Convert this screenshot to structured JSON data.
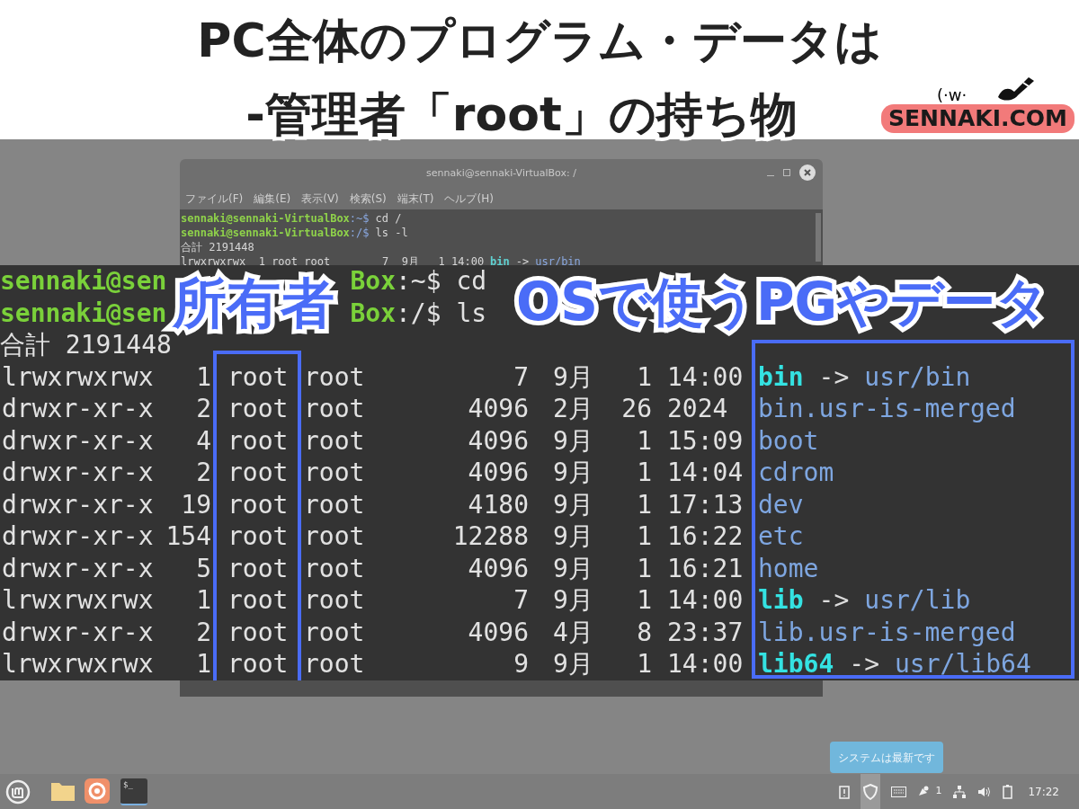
{
  "headline": [
    "PC全体のプログラム・データは",
    "-管理者「root」の持ち物"
  ],
  "logo": {
    "face": "(·w·",
    "text": "SENNAKI.COM"
  },
  "window": {
    "title": "sennaki@sennaki-VirtualBox: /",
    "menu": [
      "ファイル(F)",
      "編集(E)",
      "表示(V)",
      "検索(S)",
      "端末(T)",
      "ヘルプ(H)"
    ],
    "prompts": [
      {
        "user": "sennaki@sennaki-VirtualBox",
        "path": ":~$",
        "command": "cd /"
      },
      {
        "user": "sennaki@sennaki-VirtualBox",
        "path": ":/$",
        "command": "ls -l"
      }
    ],
    "total": "合計 2191448",
    "entry": {
      "info": "lrwxrwxrwx  1 root root        7  9月   1 14:00",
      "name": "bin",
      "arrow": "->",
      "target": "usr/bin"
    }
  },
  "zoom": {
    "prompts": [
      {
        "user_start": "sennaki@sen",
        "user_end": "Box",
        "rest": ":~$ cd"
      },
      {
        "user_start": "sennaki@sen",
        "user_end": "Box",
        "rest": ":/$ ls"
      }
    ],
    "total": "合計 2191448",
    "rows": [
      {
        "perms": "lrwxrwxrwx",
        "links": "1",
        "owner": "root",
        "group": "root",
        "size": "7",
        "month": "9月",
        "day": "1",
        "time": "14:00",
        "name": "bin",
        "kind": "link",
        "arrow": "->",
        "target": "usr/bin"
      },
      {
        "perms": "drwxr-xr-x",
        "links": "2",
        "owner": "root",
        "group": "root",
        "size": "4096",
        "month": "2月",
        "day": "26",
        "time": "2024",
        "name": "bin.usr-is-merged",
        "kind": "dir"
      },
      {
        "perms": "drwxr-xr-x",
        "links": "4",
        "owner": "root",
        "group": "root",
        "size": "4096",
        "month": "9月",
        "day": "1",
        "time": "15:09",
        "name": "boot",
        "kind": "dir"
      },
      {
        "perms": "drwxr-xr-x",
        "links": "2",
        "owner": "root",
        "group": "root",
        "size": "4096",
        "month": "9月",
        "day": "1",
        "time": "14:04",
        "name": "cdrom",
        "kind": "dir"
      },
      {
        "perms": "drwxr-xr-x",
        "links": "19",
        "owner": "root",
        "group": "root",
        "size": "4180",
        "month": "9月",
        "day": "1",
        "time": "17:13",
        "name": "dev",
        "kind": "dir"
      },
      {
        "perms": "drwxr-xr-x",
        "links": "154",
        "owner": "root",
        "group": "root",
        "size": "12288",
        "month": "9月",
        "day": "1",
        "time": "16:22",
        "name": "etc",
        "kind": "dir"
      },
      {
        "perms": "drwxr-xr-x",
        "links": "5",
        "owner": "root",
        "group": "root",
        "size": "4096",
        "month": "9月",
        "day": "1",
        "time": "16:21",
        "name": "home",
        "kind": "dir"
      },
      {
        "perms": "lrwxrwxrwx",
        "links": "1",
        "owner": "root",
        "group": "root",
        "size": "7",
        "month": "9月",
        "day": "1",
        "time": "14:00",
        "name": "lib",
        "kind": "link",
        "arrow": "->",
        "target": "usr/lib"
      },
      {
        "perms": "drwxr-xr-x",
        "links": "2",
        "owner": "root",
        "group": "root",
        "size": "4096",
        "month": "4月",
        "day": "8",
        "time": "23:37",
        "name": "lib.usr-is-merged",
        "kind": "dir"
      },
      {
        "perms": "lrwxrwxrwx",
        "links": "1",
        "owner": "root",
        "group": "root",
        "size": "9",
        "month": "9月",
        "day": "1",
        "time": "14:00",
        "name": "lib64",
        "kind": "link",
        "arrow": "->",
        "target": "usr/lib64"
      }
    ]
  },
  "labels": {
    "owner": "所有者",
    "system": "OSで使うPGやデータ"
  },
  "notification": "システムは最新です",
  "taskbar": {
    "launchers": [
      {
        "kind": "folder",
        "running": false
      },
      {
        "kind": "browser",
        "running": false
      },
      {
        "kind": "terminal",
        "running": true,
        "glyph": "$_"
      }
    ],
    "notification_count": "1",
    "clock": "17:22"
  }
}
